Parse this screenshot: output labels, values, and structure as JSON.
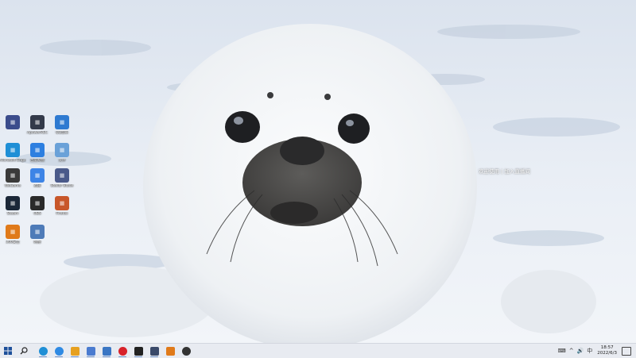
{
  "desktop": {
    "overlay_text": "欢迎使用 | 加入直播间",
    "icons": [
      {
        "label": "",
        "icon": "mail-icon",
        "color": "#3b4c8c"
      },
      {
        "label": "ApowerREC",
        "icon": "recorder-icon",
        "color": "#333a4a"
      },
      {
        "label": "QQ音乐",
        "icon": "bird-icon",
        "color": "#2e7ad1"
      },
      {
        "label": "Microsoft Edge",
        "icon": "edge-icon",
        "color": "#1f8fd6"
      },
      {
        "label": "百度网盘",
        "icon": "cloud-icon",
        "color": "#2d7fe0"
      },
      {
        "label": "文件",
        "icon": "file-icon",
        "color": "#6aa1d8"
      },
      {
        "label": "WeGame",
        "icon": "game-icon",
        "color": "#3a3a3a"
      },
      {
        "label": "迅雷",
        "icon": "thunder-icon",
        "color": "#3d84e6"
      },
      {
        "label": "Stellar Blade",
        "icon": "sword-icon",
        "color": "#4a5a8a"
      },
      {
        "label": "Steam",
        "icon": "steam-icon",
        "color": "#1b2838"
      },
      {
        "label": "OBS",
        "icon": "obs-icon",
        "color": "#2a2a2a"
      },
      {
        "label": "Firefox",
        "icon": "fox-icon",
        "color": "#c8572a"
      },
      {
        "label": "360安全",
        "icon": "app-icon",
        "color": "#e07a1a"
      },
      {
        "label": "网络",
        "icon": "network-icon",
        "color": "#4e7bb8"
      }
    ]
  },
  "taskbar": {
    "start": "start-icon",
    "search": "search-icon",
    "pinned": [
      {
        "icon": "edge-icon",
        "color": "#1f8fd6"
      },
      {
        "icon": "browser-icon",
        "color": "#2f8ae3"
      },
      {
        "icon": "cat-icon",
        "color": "#e6a020"
      },
      {
        "icon": "settings-icon",
        "color": "#4a7bd0"
      },
      {
        "icon": "store-icon",
        "color": "#3a76c4"
      },
      {
        "icon": "netease-icon",
        "color": "#d8222a"
      },
      {
        "icon": "record-icon",
        "color": "#222222"
      },
      {
        "icon": "tool-icon",
        "color": "#3a4a6a"
      },
      {
        "icon": "image-icon",
        "color": "#e07a1a"
      },
      {
        "icon": "circle-app-icon",
        "color": "#333333"
      }
    ],
    "tray": {
      "keyboard": "⌨",
      "chevron": "^",
      "volume": "🔊",
      "ime": "中"
    },
    "clock": {
      "time": "18:57",
      "date": "2022/6/3"
    }
  }
}
